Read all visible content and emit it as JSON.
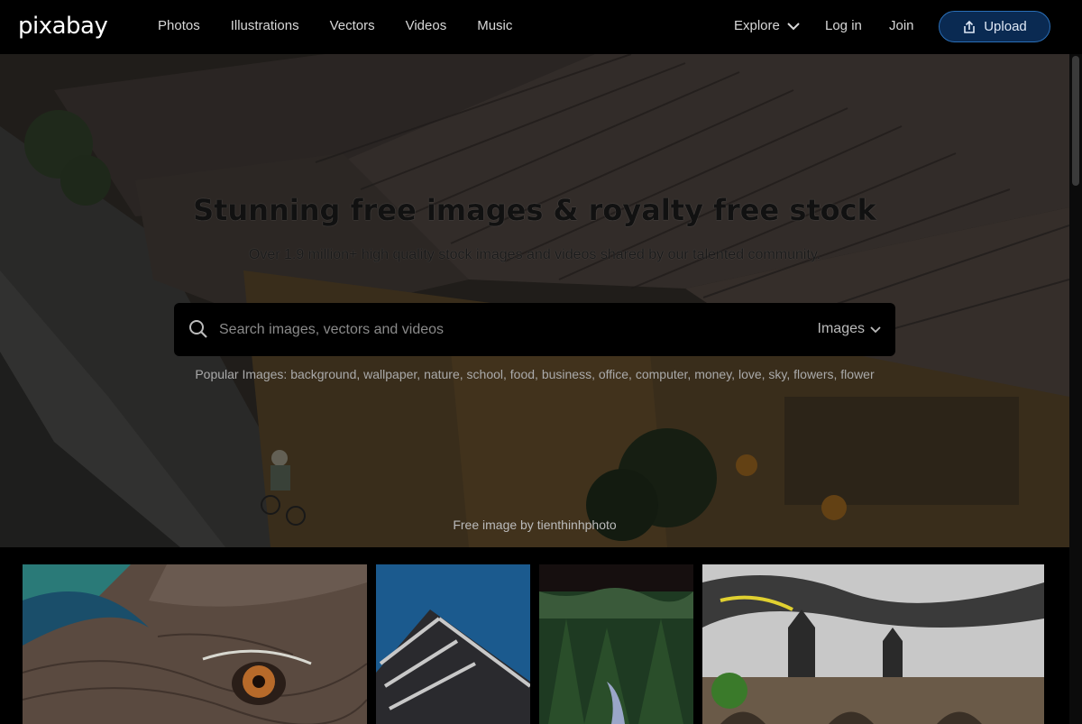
{
  "brand": {
    "logo_text": "pixabay"
  },
  "nav": {
    "items": [
      "Photos",
      "Illustrations",
      "Vectors",
      "Videos",
      "Music"
    ],
    "explore": "Explore",
    "login": "Log in",
    "join": "Join",
    "upload": "Upload"
  },
  "hero": {
    "title": "Stunning free images & royalty free stock",
    "subtitle": "Over 1.9 million+ high quality stock images and videos shared by our talented community.",
    "search": {
      "placeholder": "Search images, vectors and videos",
      "type": "Images"
    },
    "popular_label": "Popular Images:",
    "popular_terms": "background, wallpaper, nature, school, food, business, office, computer, money, love, sky, flowers, flower",
    "credit": "Free image by tienthinhphoto"
  },
  "colors": {
    "upload_bg": "#0a2a52",
    "upload_border": "#2a6fb8",
    "page_bg": "#000000"
  },
  "icons": {
    "search": "magnifier-icon",
    "upload": "upload-icon",
    "chevron": "chevron-down-icon"
  }
}
